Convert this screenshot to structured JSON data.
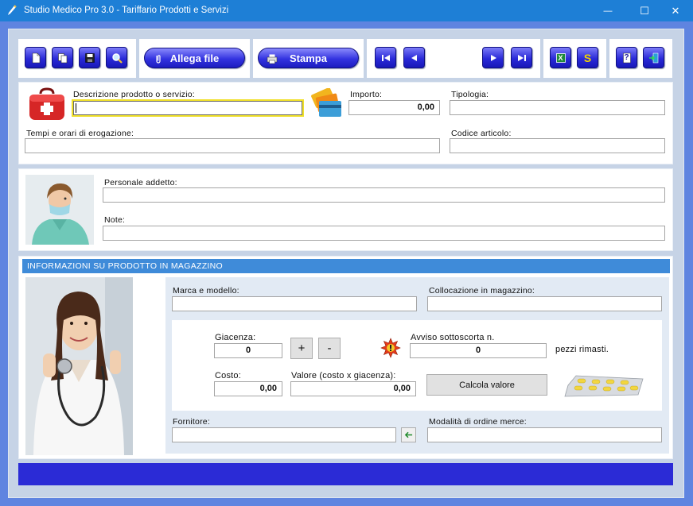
{
  "window": {
    "title": "Studio Medico Pro 3.0 - Tariffario Prodotti e Servizi",
    "minimize_glyph": "—",
    "maximize_glyph": "☐",
    "close_glyph": "✕"
  },
  "toolbar": {
    "attach_label": "Allega file",
    "print_label": "Stampa",
    "excel_glyph": "X",
    "currency_glyph": "S",
    "help_glyph": "?"
  },
  "form": {
    "descrizione_label": "Descrizione prodotto o servizio:",
    "descrizione_value": "",
    "importo_label": "Importo:",
    "importo_value": "0,00",
    "tipologia_label": "Tipologia:",
    "tipologia_value": "",
    "tempi_label": "Tempi e orari di erogazione:",
    "tempi_value": "",
    "codice_label": "Codice articolo:",
    "codice_value": "",
    "personale_label": "Personale addetto:",
    "personale_value": "",
    "note_label": "Note:",
    "note_value": ""
  },
  "magazzino": {
    "header": "INFORMAZIONI SU PRODOTTO IN MAGAZZINO",
    "marca_label": "Marca e modello:",
    "marca_value": "",
    "collocazione_label": "Collocazione in magazzino:",
    "collocazione_value": "",
    "giacenza_label": "Giacenza:",
    "giacenza_value": "0",
    "plus_label": "+",
    "minus_label": "-",
    "avviso_label": "Avviso sottoscorta n.",
    "avviso_value": "0",
    "pezzi_label": "pezzi rimasti.",
    "costo_label": "Costo:",
    "costo_value": "0,00",
    "valore_label": "Valore (costo x giacenza):",
    "valore_value": "0,00",
    "calcola_label": "Calcola valore",
    "fornitore_label": "Fornitore:",
    "fornitore_value": "",
    "modalita_label": "Modalità di ordine merce:",
    "modalita_value": ""
  },
  "colors": {
    "titlebar": "#1e7fd6",
    "frame": "#5f84e0",
    "button_blue": "#2a2ad8",
    "band": "#3f8bd9",
    "statusbar": "#2b2bd6",
    "active_field": "#f0e02a"
  }
}
